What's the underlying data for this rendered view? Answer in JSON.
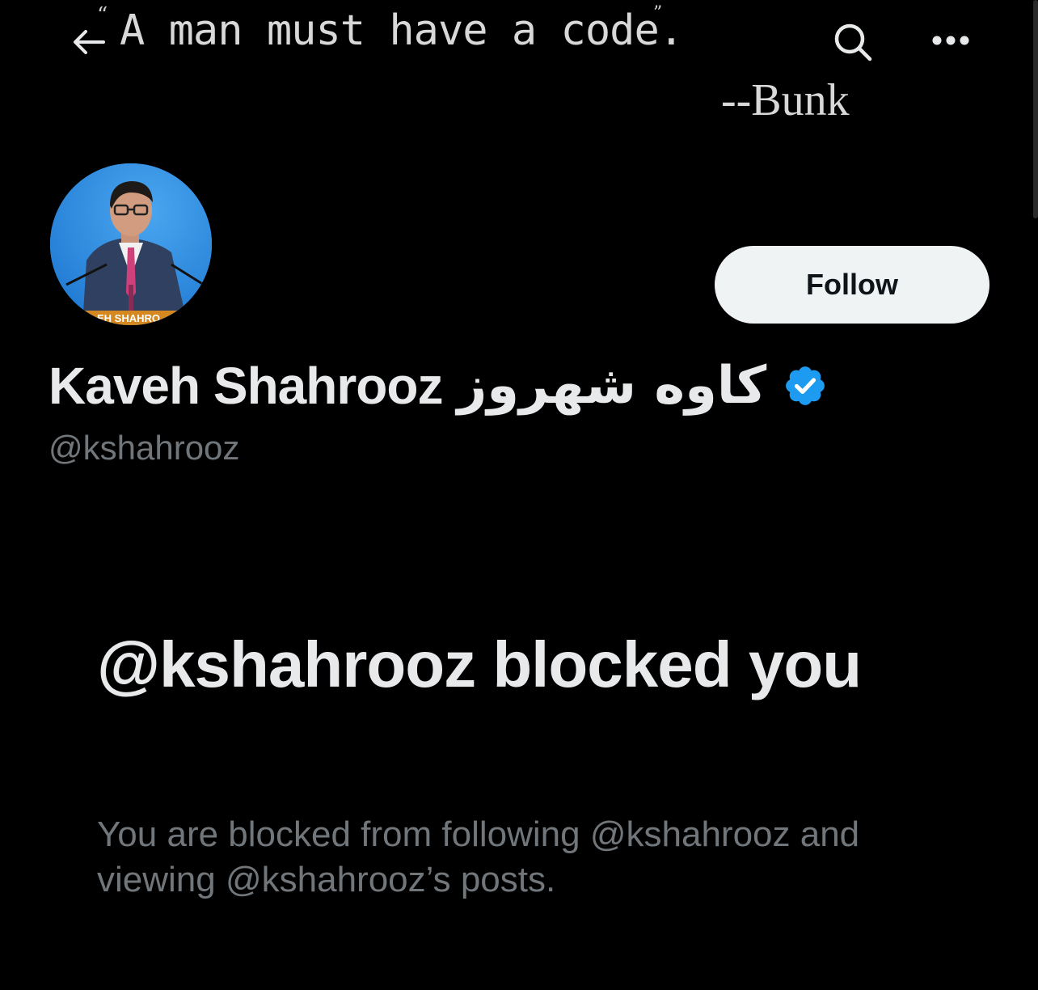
{
  "banner": {
    "quote": "A man must have a code.",
    "quote_open": "“",
    "quote_close": "”",
    "attribution": "--Bunk"
  },
  "header": {
    "back_icon": "arrow-left-icon",
    "search_icon": "search-icon",
    "more_icon": "more-horizontal-icon"
  },
  "profile": {
    "display_name": "Kaveh Shahrooz",
    "display_name_persian": "کاوه شهروز",
    "verified_icon": "verified-badge-icon",
    "verified_color": "#1d9bf0",
    "handle": "@kshahrooz",
    "follow_label": "Follow",
    "avatar_nameplate": "EH SHAHRO"
  },
  "blocked": {
    "title": "@kshahrooz blocked you",
    "description": "You are blocked from following @kshahrooz and viewing @kshahrooz’s posts."
  },
  "colors": {
    "background": "#000000",
    "primary_text": "#e7e9ea",
    "secondary_text": "#71767b",
    "follow_bg": "#eff3f4",
    "accent": "#1d9bf0"
  }
}
